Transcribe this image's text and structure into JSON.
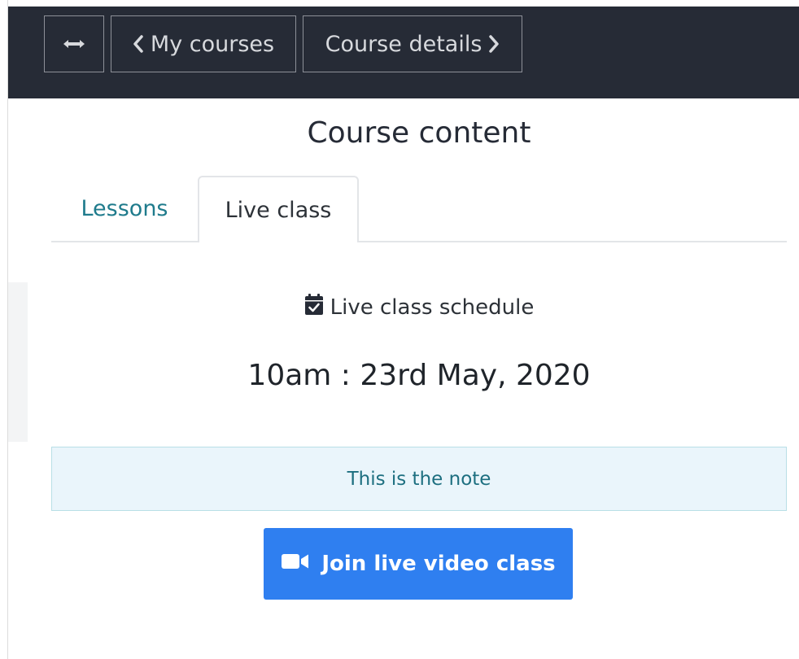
{
  "nav": {
    "toggle_icon": "expand-horizontal-icon",
    "back_icon": "chevron-left-icon",
    "back_label": "My courses",
    "forward_label": "Course details",
    "forward_icon": "chevron-right-icon"
  },
  "page": {
    "title": "Course content"
  },
  "tabs": [
    {
      "label": "Lessons",
      "active": false
    },
    {
      "label": "Live class",
      "active": true
    }
  ],
  "schedule": {
    "icon": "calendar-check-icon",
    "heading": "Live class schedule",
    "time": "10am : 23rd May, 2020"
  },
  "note": {
    "text": "This is the note"
  },
  "join": {
    "icon": "video-camera-icon",
    "label": "Join live video class"
  },
  "colors": {
    "topbar": "#262b36",
    "accent_teal": "#1f7b8c",
    "button_blue": "#2f7ff0",
    "note_bg": "#eaf5fb"
  }
}
